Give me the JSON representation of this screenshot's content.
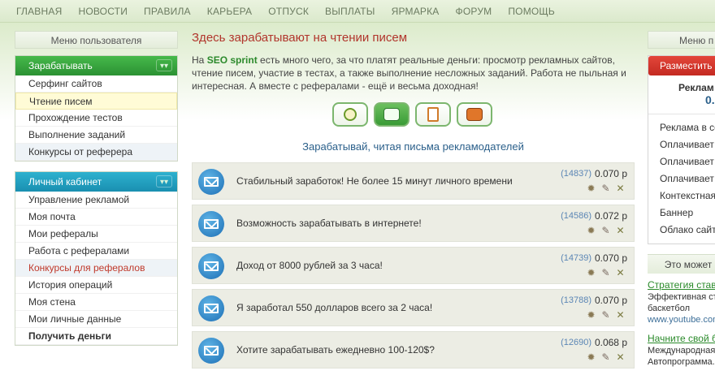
{
  "nav": [
    "ГЛАВНАЯ",
    "НОВОСТИ",
    "ПРАВИЛА",
    "КАРЬЕРА",
    "ОТПУСК",
    "ВЫПЛАТЫ",
    "ЯРМАРКА",
    "ФОРУМ",
    "ПОМОЩЬ"
  ],
  "left": {
    "menu_title": "Меню пользователя",
    "earn_title": "Зарабатывать",
    "earn_items": [
      "Серфинг сайтов",
      "Чтение писем",
      "Прохождение тестов",
      "Выполнение заданий",
      "Конкурсы от реферера"
    ],
    "cabinet_title": "Личный кабинет",
    "cabinet_items": [
      "Управление рекламой",
      "Моя почта",
      "Мои рефералы",
      "Работа с рефералами",
      "Конкурсы для рефералов",
      "История операций",
      "Моя стена",
      "Мои личные данные",
      "Получить деньги"
    ]
  },
  "center": {
    "title": "Здесь зарабатывают на чтении писем",
    "intro_pre": "На",
    "intro_brand": "SEO sprint",
    "intro_post": "есть много чего, за что платят реальные деньги: просмотр рекламных сайтов, чтение писем, участие в тестах, а также выполнение несложных заданий. Работа не пыльная и интересная. А вместе с рефералами - ещё и весьма доходная!",
    "subtitle": "Зарабатывай, читая письма рекламодателей",
    "rows": [
      {
        "text": "Стабильный заработок! Не более 15 минут личного времени",
        "count": "(14837)",
        "price": "0.070 р"
      },
      {
        "text": "Возможность зарабатывать в интернете!",
        "count": "(14586)",
        "price": "0.072 р"
      },
      {
        "text": "Доход от 8000 рублей за 3 часа!",
        "count": "(14739)",
        "price": "0.070 р"
      },
      {
        "text": "Я заработал 550 долларов всего за 2 часа!",
        "count": "(13788)",
        "price": "0.070 р"
      },
      {
        "text": "Хотите зарабатывать ежедневно 100-120$?",
        "count": "(12690)",
        "price": "0.068 р"
      }
    ]
  },
  "right": {
    "menu_title": "Меню п",
    "place_button": "Разместить",
    "ad_title": "Реклам",
    "ad_value": "0.",
    "items": [
      "Реклама в се",
      "Оплачивает",
      "Оплачивает",
      "Оплачивает",
      "Контекстная",
      "Баннер",
      "Облако сайт"
    ],
    "section_title": "Это может",
    "ads": [
      {
        "link": "Стратегия став",
        "text1": "Эффективная ст",
        "text2": "баскетбол",
        "url": "www.youtube.com"
      },
      {
        "link": "Начните свой б",
        "text1": "Международная",
        "text2": "Автопрограмма.",
        "url": ""
      }
    ]
  }
}
